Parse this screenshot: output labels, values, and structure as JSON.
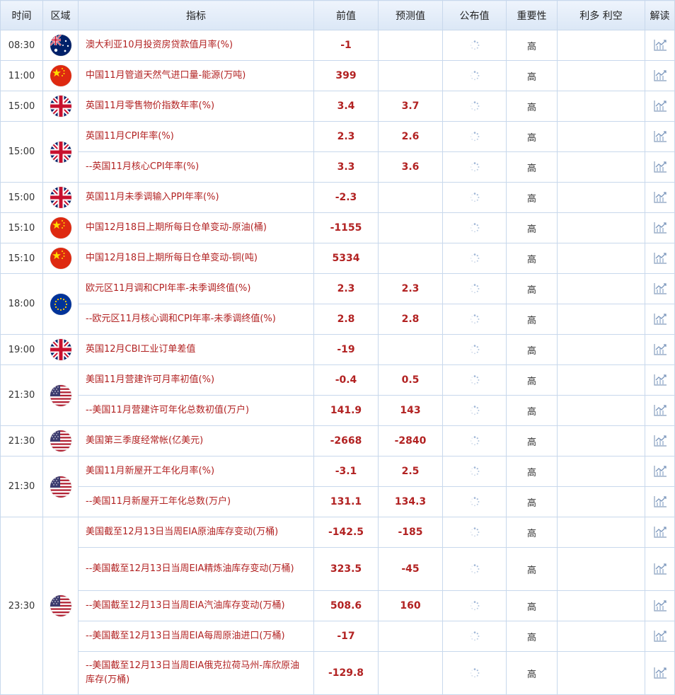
{
  "headers": [
    "时间",
    "区域",
    "指标",
    "前值",
    "预测值",
    "公布值",
    "重要性",
    "利多 利空",
    "解读"
  ],
  "groups": [
    {
      "time": "08:30",
      "flag": "australia-flag",
      "rows": [
        {
          "indicator": "澳大利亚10月投资房贷款值月率(%)",
          "previous": "-1",
          "forecast": "",
          "importance": "高"
        }
      ]
    },
    {
      "time": "11:00",
      "flag": "china-flag",
      "rows": [
        {
          "indicator": "中国11月管道天然气进口量-能源(万吨)",
          "previous": "399",
          "forecast": "",
          "importance": "高"
        }
      ]
    },
    {
      "time": "15:00",
      "flag": "uk-flag",
      "rows": [
        {
          "indicator": "英国11月零售物价指数年率(%)",
          "previous": "3.4",
          "forecast": "3.7",
          "importance": "高"
        }
      ]
    },
    {
      "time": "15:00",
      "flag": "uk-flag",
      "rows": [
        {
          "indicator": "英国11月CPI年率(%)",
          "previous": "2.3",
          "forecast": "2.6",
          "importance": "高"
        },
        {
          "indicator": "--英国11月核心CPI年率(%)",
          "previous": "3.3",
          "forecast": "3.6",
          "importance": "高"
        }
      ]
    },
    {
      "time": "15:00",
      "flag": "uk-flag",
      "rows": [
        {
          "indicator": "英国11月未季调输入PPI年率(%)",
          "previous": "-2.3",
          "forecast": "",
          "importance": "高"
        }
      ]
    },
    {
      "time": "15:10",
      "flag": "china-flag",
      "rows": [
        {
          "indicator": "中国12月18日上期所每日仓单变动-原油(桶)",
          "previous": "-1155",
          "forecast": "",
          "importance": "高"
        }
      ]
    },
    {
      "time": "15:10",
      "flag": "china-flag",
      "rows": [
        {
          "indicator": "中国12月18日上期所每日仓单变动-铜(吨)",
          "previous": "5334",
          "forecast": "",
          "importance": "高"
        }
      ]
    },
    {
      "time": "18:00",
      "flag": "eu-flag",
      "rows": [
        {
          "indicator": "欧元区11月调和CPI年率-未季调终值(%)",
          "previous": "2.3",
          "forecast": "2.3",
          "importance": "高"
        },
        {
          "indicator": "--欧元区11月核心调和CPI年率-未季调终值(%)",
          "previous": "2.8",
          "forecast": "2.8",
          "importance": "高"
        }
      ]
    },
    {
      "time": "19:00",
      "flag": "uk-flag",
      "rows": [
        {
          "indicator": "英国12月CBI工业订单差值",
          "previous": "-19",
          "forecast": "",
          "importance": "高"
        }
      ]
    },
    {
      "time": "21:30",
      "flag": "us-flag",
      "rows": [
        {
          "indicator": "美国11月营建许可月率初值(%)",
          "previous": "-0.4",
          "forecast": "0.5",
          "importance": "高"
        },
        {
          "indicator": "--美国11月营建许可年化总数初值(万户)",
          "previous": "141.9",
          "forecast": "143",
          "importance": "高"
        }
      ]
    },
    {
      "time": "21:30",
      "flag": "us-flag",
      "rows": [
        {
          "indicator": "美国第三季度经常帐(亿美元)",
          "previous": "-2668",
          "forecast": "-2840",
          "importance": "高"
        }
      ]
    },
    {
      "time": "21:30",
      "flag": "us-flag",
      "rows": [
        {
          "indicator": "美国11月新屋开工年化月率(%)",
          "previous": "-3.1",
          "forecast": "2.5",
          "importance": "高"
        },
        {
          "indicator": "--美国11月新屋开工年化总数(万户)",
          "previous": "131.1",
          "forecast": "134.3",
          "importance": "高"
        }
      ]
    },
    {
      "time": "23:30",
      "flag": "us-flag",
      "rows": [
        {
          "indicator": "美国截至12月13日当周EIA原油库存变动(万桶)",
          "previous": "-142.5",
          "forecast": "-185",
          "importance": "高"
        },
        {
          "indicator": "--美国截至12月13日当周EIA精炼油库存变动(万桶)",
          "previous": "323.5",
          "forecast": "-45",
          "importance": "高",
          "tall": true
        },
        {
          "indicator": "--美国截至12月13日当周EIA汽油库存变动(万桶)",
          "previous": "508.6",
          "forecast": "160",
          "importance": "高"
        },
        {
          "indicator": "--美国截至12月13日当周EIA每周原油进口(万桶)",
          "previous": "-17",
          "forecast": "",
          "importance": "高"
        },
        {
          "indicator": "--美国截至12月13日当周EIA俄克拉荷马州-库欣原油库存(万桶)",
          "previous": "-129.8",
          "forecast": "",
          "importance": "高",
          "tall": true
        }
      ]
    }
  ],
  "icons": {
    "published": "loading-spinner-icon",
    "analysis": "analysis-chart-icon"
  }
}
